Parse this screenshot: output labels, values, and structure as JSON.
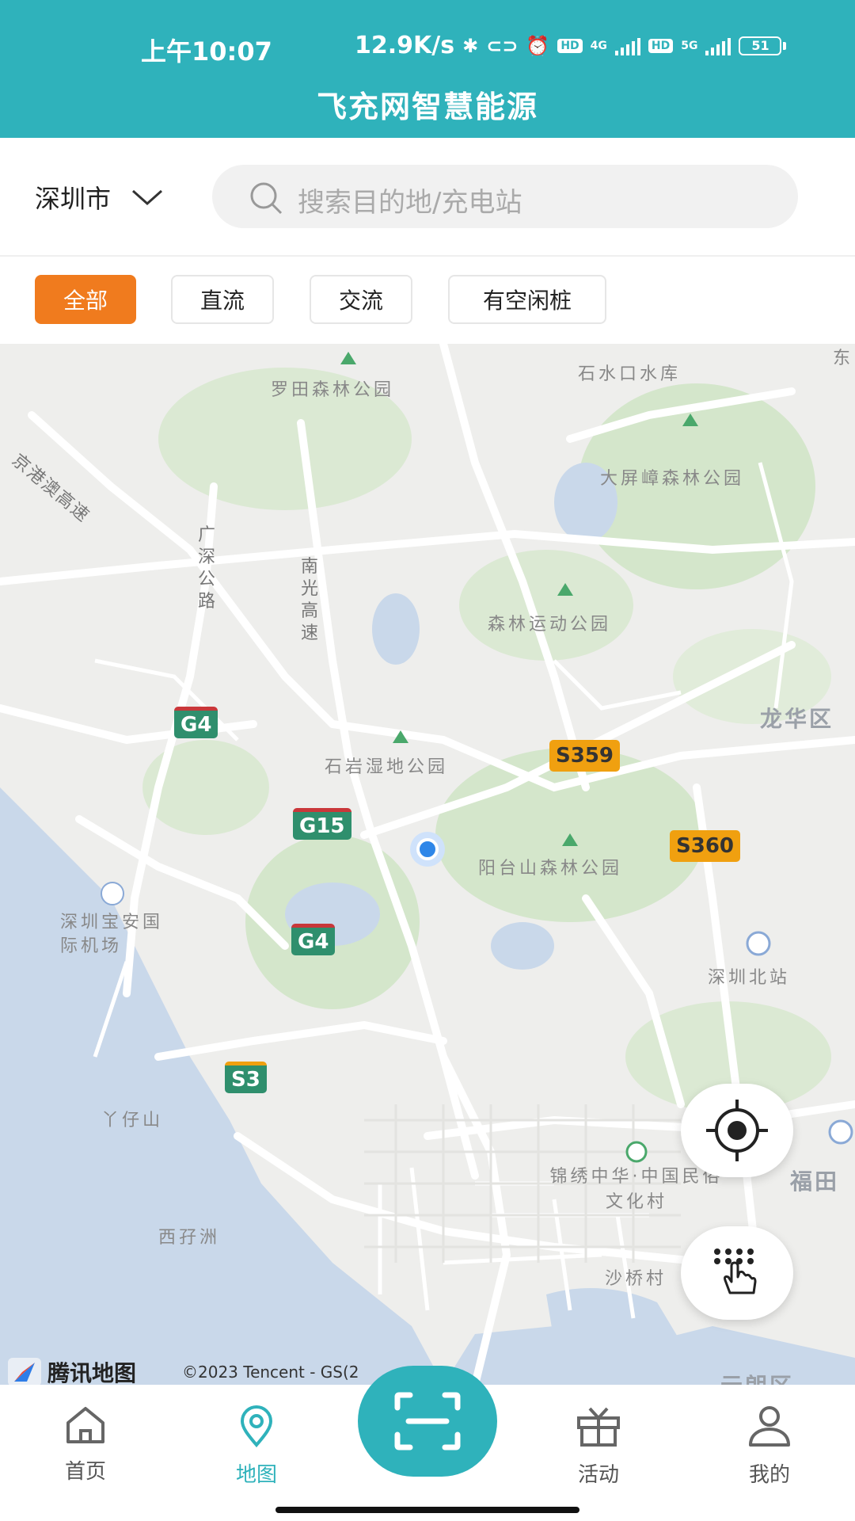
{
  "status_bar": {
    "time": "上午10:07",
    "speed": "12.9K/s",
    "net1": "4G",
    "net2": "5G",
    "hd": "HD",
    "battery": "51"
  },
  "header": {
    "title": "飞充网智慧能源"
  },
  "search": {
    "city": "深圳市",
    "placeholder": "搜索目的地/充电站"
  },
  "filters": [
    {
      "label": "全部",
      "active": true
    },
    {
      "label": "直流",
      "active": false
    },
    {
      "label": "交流",
      "active": false
    },
    {
      "label": "有空闲桩",
      "active": false
    }
  ],
  "map": {
    "labels": {
      "luotian": "罗田森林公园",
      "shishui": "石水口水库",
      "dongcorner": "东",
      "jinggang": "京港澳高速",
      "dapingzhang": "大屏嶂森林公园",
      "guangshen": "广深公路",
      "nanguang": "南光高速",
      "senlin": "森林运动公园",
      "longhua": "龙华区",
      "shiyan": "石岩湿地公园",
      "yangtai": "阳台山森林公园",
      "airport": "深圳宝安国际机场",
      "beizhan": "深圳北站",
      "yazaishan": "丫仔山",
      "jinxiu": "锦绣中华·中国民俗文化村",
      "futian": "福田",
      "xizizhou": "西孖洲",
      "shaqiao": "沙桥村",
      "yuanlang": "元朗区"
    },
    "shields": {
      "g4a": "G4",
      "g15": "G15",
      "g4b": "G4",
      "s359": "S359",
      "s360": "S360",
      "s3": "S3"
    },
    "logo_text": "腾讯地图",
    "copyright": "©2023 Tencent - GS(2"
  },
  "tabs": [
    {
      "label": "首页",
      "icon": "home-icon"
    },
    {
      "label": "地图",
      "icon": "map-pin-icon",
      "active": true
    },
    {
      "label": "活动",
      "icon": "gift-icon"
    },
    {
      "label": "我的",
      "icon": "user-icon"
    }
  ],
  "colors": {
    "primary": "#2fb2bb",
    "accent": "#f07b1e"
  }
}
